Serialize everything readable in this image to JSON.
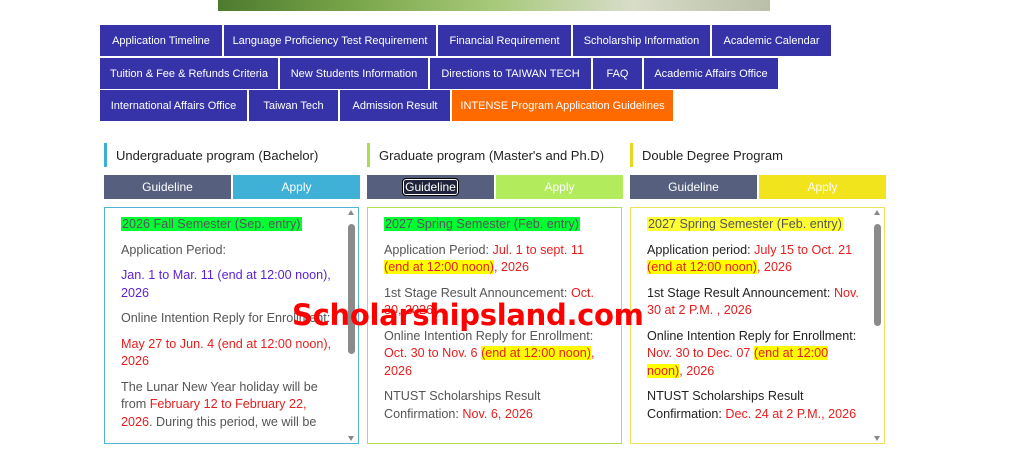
{
  "nav": {
    "row1": [
      "Application Timeline",
      "Language Proficiency Test Requirement",
      "Financial Requirement",
      "Scholarship Information",
      "Academic Calendar"
    ],
    "row2": [
      "Tuition & Fee & Refunds Criteria",
      "New Students Information",
      "Directions to TAIWAN TECH",
      "FAQ",
      "Academic Affairs Office"
    ],
    "row3": [
      "International Affairs Office",
      "Taiwan Tech",
      "Admission Result",
      "INTENSE Program Application Guidelines"
    ]
  },
  "colors": {
    "nav": "#3633a8",
    "highlight": "#ff6a00",
    "guideline": "#56607e"
  },
  "columns": [
    {
      "title": "Undergraduate program (Bachelor)",
      "guideline": "Guideline",
      "apply": "Apply",
      "semester": "2026 Fall Semester (Sep. entry)",
      "app_label": "Application Period:",
      "app_dates": "Jan. 1 to Mar. 11 (end at 12:00 noon), 2026",
      "reply_label": "Online Intention Reply for Enrollment:",
      "reply_dates": "May 27 to Jun. 4 (end at 12:00 noon), 2026",
      "holiday_a": "The Lunar New Year holiday will be from ",
      "holiday_b": "February 12 to February 22, 2026",
      "holiday_c": ". During this period, we will be"
    },
    {
      "title": "Graduate program (Master's and Ph.D)",
      "guideline": "Guideline",
      "apply": "Apply",
      "semester": "2027 Spring Semester (Feb. entry)",
      "app_label": "Application Period: ",
      "app_dates": "Jul. 1 to sept. 11 ",
      "app_noon": "(end at 12:00 noon)",
      "app_year": ", 2026",
      "result_label": "1st  Stage Result Announcement: ",
      "result_date": "Oct. 30, 2026",
      "reply_label": "Online Intention Reply for Enrollment: ",
      "reply_dates": "Oct. 30 to Nov. 6 ",
      "reply_noon": "(end at 12:00 noon)",
      "reply_year": ", 2026",
      "scholar_label": "NTUST Scholarships Result Confirmation: ",
      "scholar_date": "Nov. 6, 2026"
    },
    {
      "title": "Double Degree Program",
      "guideline": "Guideline",
      "apply": "Apply",
      "semester": "2027 Spring Semester (Feb. entry)",
      "app_label": "Application period: ",
      "app_dates": "July 15 to Oct. 21 ",
      "app_noon": "(end at 12:00 noon)",
      "app_year": ", 2026",
      "result_label": "1st  Stage Result Announcement: ",
      "result_date": "Nov. 30 at 2 P.M. , 2026",
      "reply_label": "Online Intention Reply for Enrollment: ",
      "reply_dates": "Nov. 30 to Dec. 07 ",
      "reply_noon": "(end at 12:00 noon)",
      "reply_year": ", 2026",
      "scholar_label": "NTUST Scholarships Result Confirmation: ",
      "scholar_date": "Dec. 24 at 2 P.M., 2026"
    }
  ],
  "watermark": "Scholarshipsland.com"
}
